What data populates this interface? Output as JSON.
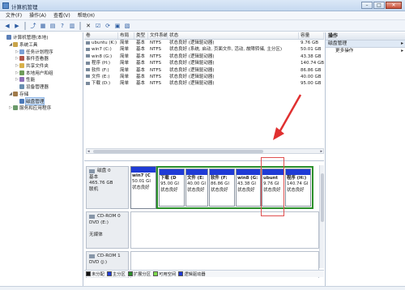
{
  "window": {
    "title": "计算机管理",
    "buttons": [
      "–",
      "□",
      "✕"
    ]
  },
  "menu": [
    "文件(F)",
    "操作(A)",
    "查看(V)",
    "帮助(H)"
  ],
  "toolbar": [
    "back-icon",
    "forward-icon",
    "up-icon",
    "console-tree-icon",
    "properties-icon",
    "help-icon",
    "show-hide-icon",
    "delete-icon",
    "properties-icon",
    "refresh-icon",
    "export-icon",
    "help-icon"
  ],
  "tree": [
    {
      "label": "计算机管理(本地)",
      "level": 0,
      "expander": "",
      "icon": "computer-icon"
    },
    {
      "label": "系统工具",
      "level": 1,
      "expander": "◢",
      "icon": "tools-icon"
    },
    {
      "label": "任务计划程序",
      "level": 2,
      "expander": "▷",
      "icon": "clock-icon"
    },
    {
      "label": "事件查看器",
      "level": 2,
      "expander": "▷",
      "icon": "event-icon"
    },
    {
      "label": "共享文件夹",
      "level": 2,
      "expander": "▷",
      "icon": "folder-icon"
    },
    {
      "label": "本地用户和组",
      "level": 2,
      "expander": "▷",
      "icon": "users-icon"
    },
    {
      "label": "性能",
      "level": 2,
      "expander": "▷",
      "icon": "performance-icon"
    },
    {
      "label": "设备管理器",
      "level": 2,
      "expander": "",
      "icon": "device-icon"
    },
    {
      "label": "存储",
      "level": 1,
      "expander": "◢",
      "icon": "storage-icon"
    },
    {
      "label": "磁盘管理",
      "level": 2,
      "expander": "",
      "icon": "disk-icon",
      "selected": true
    },
    {
      "label": "服务和应用程序",
      "level": 1,
      "expander": "▷",
      "icon": "services-icon"
    }
  ],
  "volumes": {
    "headers": [
      "卷",
      "布局",
      "类型",
      "文件系统",
      "状态",
      "容量"
    ],
    "rows": [
      [
        "ubuntu (K:)",
        "简单",
        "基本",
        "NTFS",
        "状态良好 (逻辑驱动器)",
        "9.76 GB"
      ],
      [
        "win7 (C:)",
        "简单",
        "基本",
        "NTFS",
        "状态良好 (系统, 启动, 页面文件, 活动, 故障转储, 主分区)",
        "50.01 GB"
      ],
      [
        "win8 (G:)",
        "简单",
        "基本",
        "NTFS",
        "状态良好 (逻辑驱动器)",
        "43.38 GB"
      ],
      [
        "程序 (H:)",
        "简单",
        "基本",
        "NTFS",
        "状态良好 (逻辑驱动器)",
        "140.74 GB"
      ],
      [
        "软件 (F:)",
        "简单",
        "基本",
        "NTFS",
        "状态良好 (逻辑驱动器)",
        "86.86 GB"
      ],
      [
        "文件 (E:)",
        "简单",
        "基本",
        "NTFS",
        "状态良好 (逻辑驱动器)",
        "40.00 GB"
      ],
      [
        "下载 (D:)",
        "简单",
        "基本",
        "NTFS",
        "状态良好 (逻辑驱动器)",
        "95.00 GB"
      ]
    ]
  },
  "disks": [
    {
      "name": "磁盘 0",
      "type": "基本",
      "size": "465.76 GB",
      "status": "联机",
      "partitions": [
        {
          "label": "win7 (C",
          "size": "50.01 GI",
          "status": "状态良好",
          "band": "#1f3bd6",
          "extended": false
        },
        {
          "label": "下载 (D",
          "size": "95.00 GI",
          "status": "状态良好",
          "band": "#1f3bd6",
          "extended": true
        },
        {
          "label": "文件 (E:",
          "size": "40.00 GI",
          "status": "状态良好",
          "band": "#1f3bd6",
          "extended": true
        },
        {
          "label": "软件 (F:",
          "size": "86.86 GI",
          "status": "状态良好",
          "band": "#1f3bd6",
          "extended": true
        },
        {
          "label": "win8 (G:",
          "size": "43.38 GI",
          "status": "状态良好",
          "band": "#1f3bd6",
          "extended": true
        },
        {
          "label": "ubunt",
          "size": "9.76 GI",
          "status": "状态良好",
          "band": "#1f3bd6",
          "extended": true
        },
        {
          "label": "程序 (H:)",
          "size": "140.74 GI",
          "status": "状态良好",
          "band": "#1f3bd6",
          "extended": true
        }
      ]
    },
    {
      "name": "CD-ROM 0",
      "type": "DVD (E:)",
      "status": "无媒体"
    },
    {
      "name": "CD-ROM 1",
      "type": "DVD (J:)",
      "status": ""
    }
  ],
  "legend": [
    {
      "label": "未分配",
      "color": "#111111"
    },
    {
      "label": "主分区",
      "color": "#1f3bd6"
    },
    {
      "label": "扩展分区",
      "color": "#2a8f2a"
    },
    {
      "label": "可用空间",
      "color": "#7fdc4f"
    },
    {
      "label": "逻辑驱动器",
      "color": "#1f3bd6"
    }
  ],
  "actions": {
    "header": "操作",
    "section": "磁盘管理",
    "items": [
      "更多操作"
    ],
    "marker": "▸"
  }
}
